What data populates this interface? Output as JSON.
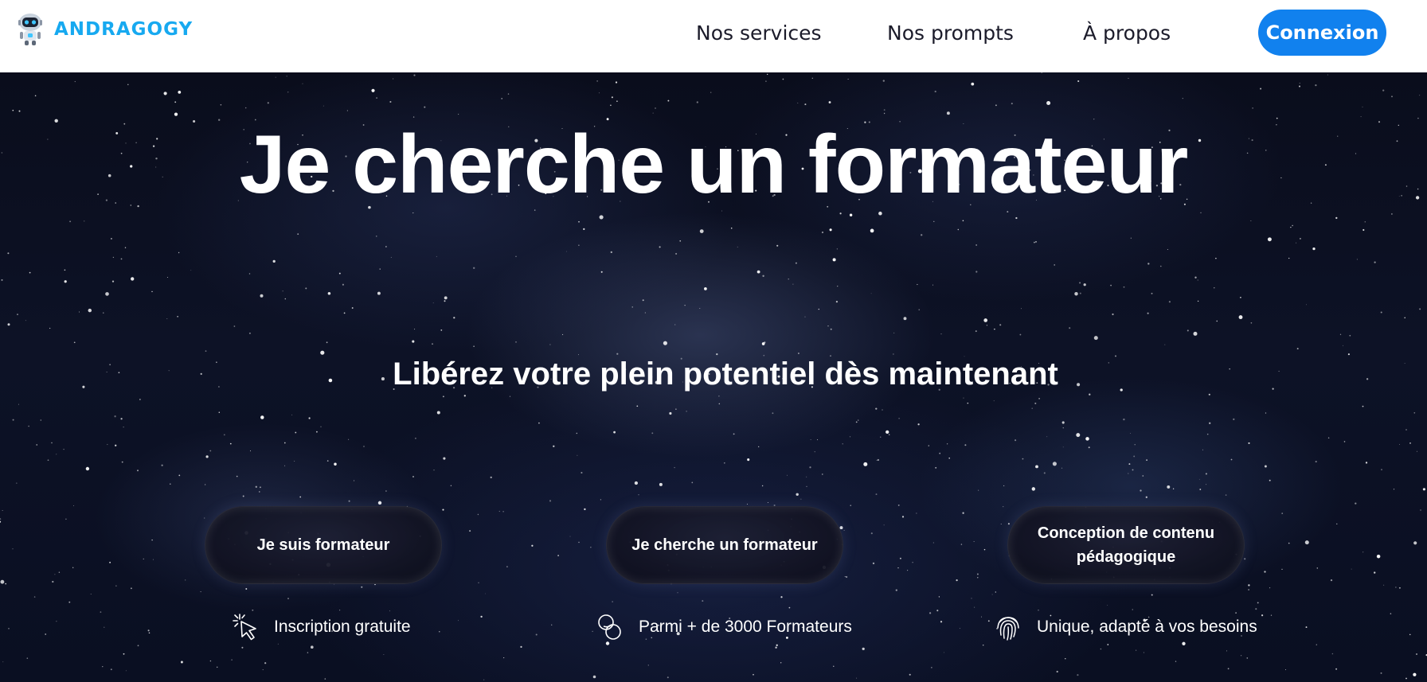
{
  "brand": {
    "name": "ANDRAGOGY",
    "color": "#17a9f0"
  },
  "nav": {
    "items": [
      {
        "label": "Nos services"
      },
      {
        "label": "Nos prompts"
      },
      {
        "label": "À propos"
      }
    ],
    "login_label": "Connexion",
    "login_color": "#1181ee"
  },
  "hero": {
    "title": "Je cherche un formateur",
    "subtitle": "Libérez votre plein potentiel dès maintenant",
    "buttons": [
      {
        "label": "Je suis formateur"
      },
      {
        "label": "Je cherche un formateur"
      },
      {
        "label": "Conception de contenu pédagogique"
      }
    ],
    "features": [
      {
        "icon": "click-cursor-icon",
        "text": "Inscription gratuite"
      },
      {
        "icon": "linked-circles-icon",
        "text": "Parmi + de 3000 Formateurs"
      },
      {
        "icon": "fingerprint-icon",
        "text": "Unique, adapté à vos besoins"
      }
    ]
  }
}
